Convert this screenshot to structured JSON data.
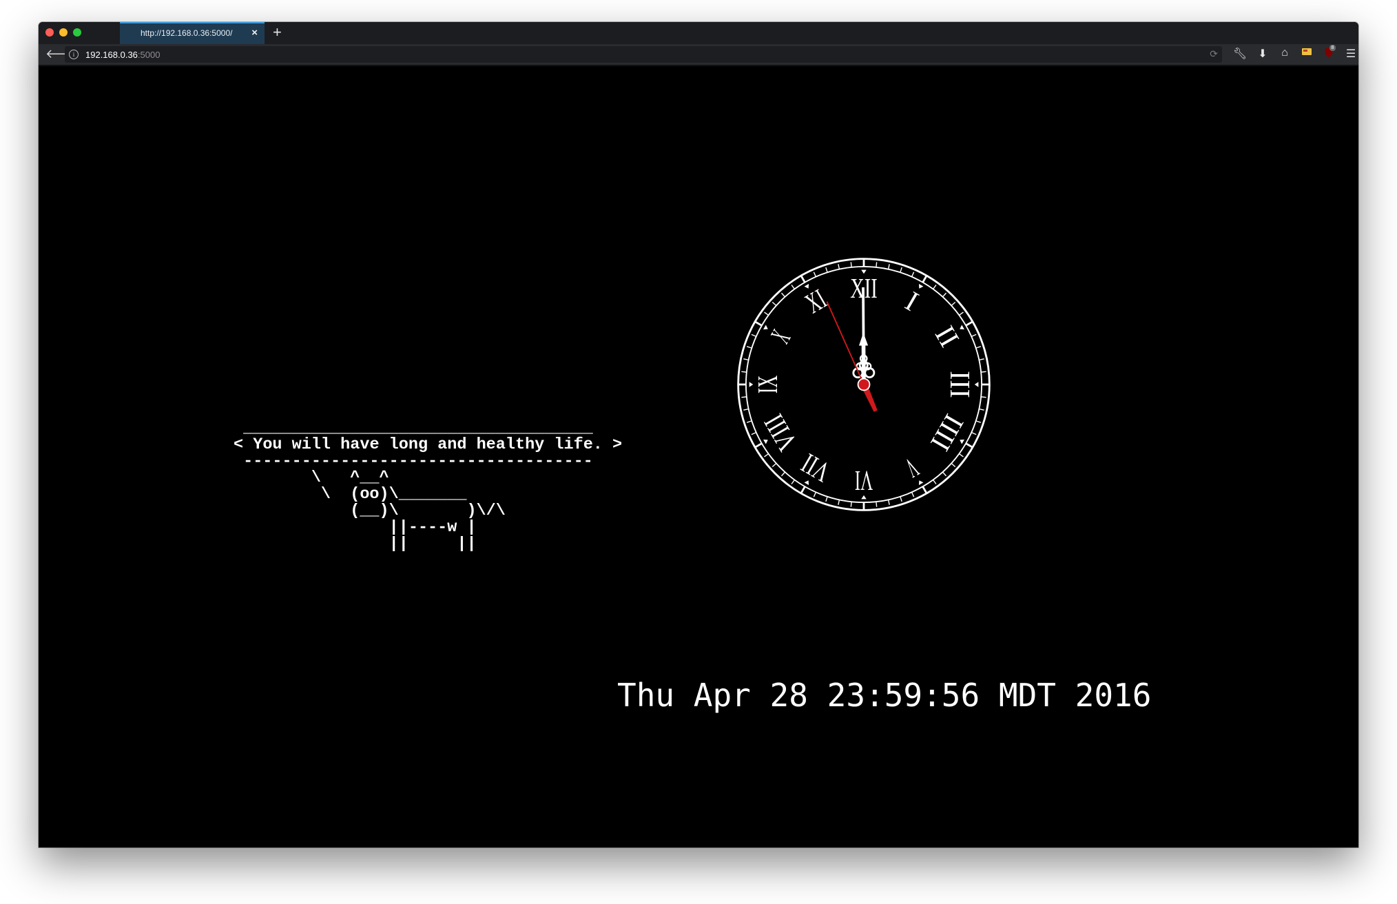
{
  "browser": {
    "tab": {
      "title": "http://192.168.0.36:5000/"
    },
    "url_host": "192.168.0.36",
    "url_port": ":5000",
    "toolbar_badge": "8"
  },
  "icons": {
    "back": "back-arrow-icon",
    "info": "info-icon",
    "reload": "reload-icon",
    "tools": [
      "wrench-icon",
      "download-icon",
      "home-icon",
      "extension-icon",
      "ublock-icon",
      "menu-icon"
    ]
  },
  "page": {
    "fortune_message": "You will have long and healthy life.",
    "datetime": "Thu Apr 28 23:59:56 MDT 2016",
    "clock": {
      "hour": 11,
      "minute": 59,
      "second": 56,
      "numerals": [
        "XII",
        "I",
        "II",
        "III",
        "IIII",
        "V",
        "VI",
        "VII",
        "VIII",
        "IX",
        "X",
        "XI"
      ]
    }
  },
  "colors": {
    "background": "#000000",
    "text": "#ffffff",
    "second_hand": "#d0191c"
  }
}
